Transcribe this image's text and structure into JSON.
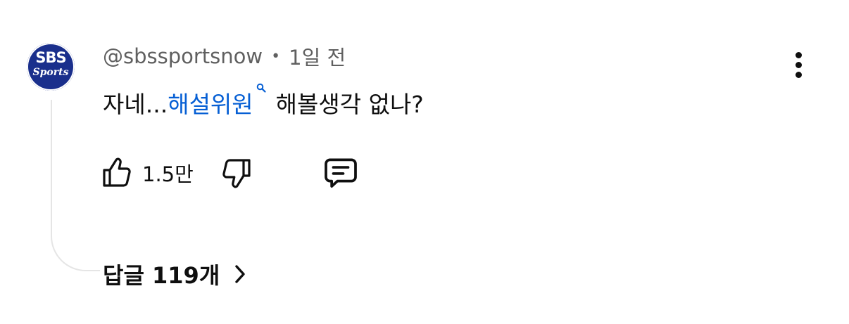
{
  "comment": {
    "avatar": {
      "logo_top": "SBS",
      "logo_bottom": "Sports",
      "color": "#1a2f8c"
    },
    "author": "@sbssportsnow",
    "separator": "•",
    "time": "1일 전",
    "text_before": "자네...",
    "search_link": "해설위원",
    "text_after": "해볼생각 없나?",
    "link_color": "#065fd4",
    "like_count": "1.5만",
    "replies_label": "답글 119개",
    "icons": {
      "more": "more-vertical-icon",
      "search": "search-icon",
      "like": "thumbs-up-icon",
      "dislike": "thumbs-down-icon",
      "reply": "comment-icon",
      "replies": "chevron-right-icon"
    }
  }
}
